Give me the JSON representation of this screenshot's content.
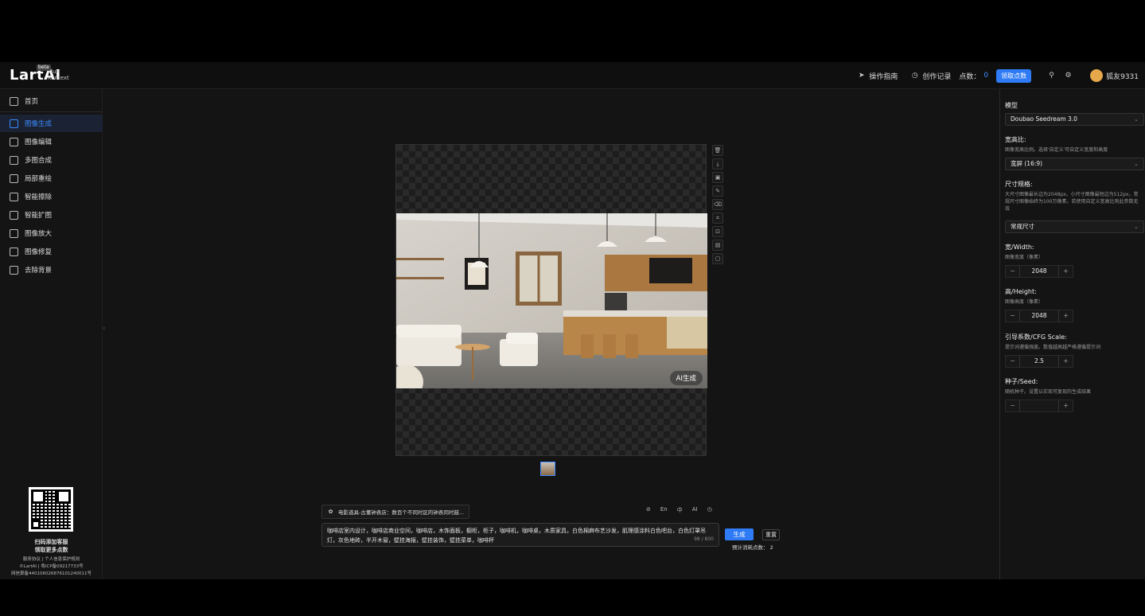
{
  "topbar": {
    "logo": "LartAI",
    "logo_sub1": "Flux",
    "logo_sub2": "Kontext",
    "logo_tag": "beta",
    "guide": "操作指南",
    "history": "创作记录",
    "points_label": "点数：",
    "points_value": "0",
    "claim_points": "领取点数",
    "username": "狐友9331"
  },
  "sidebar": {
    "items": [
      {
        "label": "首页",
        "icon": "home-icon"
      },
      {
        "label": "图像生成",
        "icon": "chat-image-icon"
      },
      {
        "label": "图像编辑",
        "icon": "image-edit-icon"
      },
      {
        "label": "多图合成",
        "icon": "multi-image-icon"
      },
      {
        "label": "局部重绘",
        "icon": "edit-icon"
      },
      {
        "label": "智能擦除",
        "icon": "eraser-icon"
      },
      {
        "label": "智能扩图",
        "icon": "crop-icon"
      },
      {
        "label": "图像放大",
        "icon": "upscale-icon"
      },
      {
        "label": "图像修复",
        "icon": "repair-icon"
      },
      {
        "label": "去除背景",
        "icon": "remove-bg-icon"
      }
    ],
    "footer": {
      "line1": "扫码添加客服",
      "line2": "领取更多点数",
      "line3": "服务协议 | 个人信息保护规则",
      "line4": "©LartAI | 粤ICP备09217733号",
      "line5": "网信算备440106026876101240011号"
    }
  },
  "canvas": {
    "ai_badge": "AI生成"
  },
  "prompt": {
    "chip": "电影道具-古董钟表店：数百个不同时区的钟表同时鼓...",
    "tools": [
      "⊘",
      "En",
      "中",
      "AI",
      "◷"
    ],
    "text": "咖啡店室内设计，咖啡店商业空间，咖啡店，木饰面板，橱柜，柜子，咖啡机，咖啡桌，木质家具，白色棉麻布艺沙发，肌理感涂料白色吧台，白色灯罩吊灯，灰色地砖，半开木窗，壁挂海报，壁挂装饰，壁挂菜单，咖啡杯",
    "counter": "98 / 800",
    "generate": "生成",
    "reset": "重置",
    "cost": "预计消耗点数： 2"
  },
  "settings": {
    "model_label": "模型",
    "model_value": "Doubao Seedream 3.0",
    "ratio_label": "宽高比:",
    "ratio_desc": "图像宽高比例。选择'自定义'可自定义宽度和高度",
    "ratio_value": "宽屏 (16:9)",
    "size_label": "尺寸规格:",
    "size_desc": "大尺寸图像最长边为2048px。小尺寸图像最短边为512px。常规尺寸图像始终为100万像素。若使用自定义宽高比则此参数无效",
    "size_value": "常规尺寸",
    "width_label": "宽/Width:",
    "width_desc": "图像宽度（像素）",
    "width_value": "2048",
    "height_label": "高/Height:",
    "height_desc": "图像高度（像素）",
    "height_value": "2048",
    "cfg_label": "引导系数/CFG Scale:",
    "cfg_desc": "提示词遵循强度。数值越高越严格遵循提示词",
    "cfg_value": "2.5",
    "seed_label": "种子/Seed:",
    "seed_desc": "随机种子。设置以实现可复现的生成结果",
    "seed_value": ""
  }
}
